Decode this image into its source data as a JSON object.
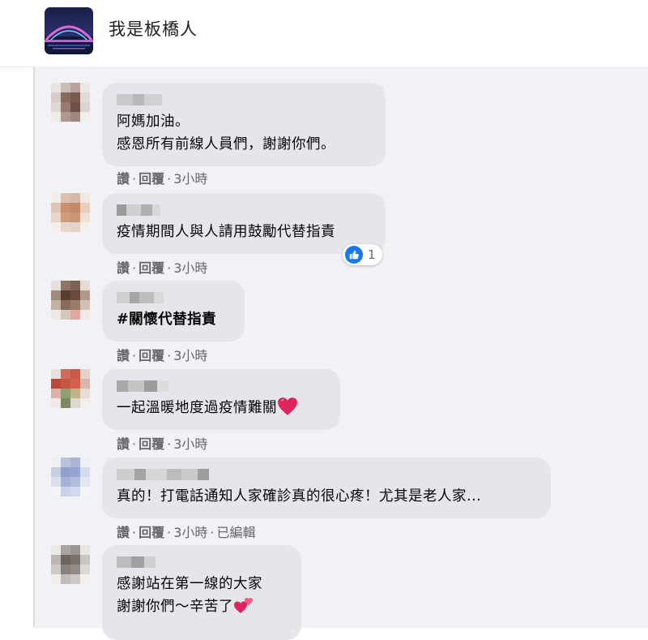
{
  "group": {
    "name": "我是板橋人"
  },
  "comments": [
    {
      "lines": [
        "阿媽加油。",
        "感恩所有前線人員們，謝謝你們。"
      ],
      "actions": {
        "like": "讚",
        "reply": "回覆",
        "time": "3小時"
      }
    },
    {
      "lines": [
        "疫情期間人與人請用鼓勵代替指責"
      ],
      "actions": {
        "like": "讚",
        "reply": "回覆",
        "time": "3小時"
      },
      "reaction": {
        "icon": "thumbs-up-icon",
        "count": "1"
      }
    },
    {
      "lines": [
        "#關懷代替指責"
      ],
      "actions": {
        "like": "讚",
        "reply": "回覆",
        "time": "3小時"
      }
    },
    {
      "lines": [
        "一起溫暖地度過疫情難關"
      ],
      "emoji": "red-heart-icon",
      "actions": {
        "like": "讚",
        "reply": "回覆",
        "time": "3小時"
      }
    },
    {
      "lines": [
        "真的！打電話通知人家確診真的很心疼！尤其是老人家..."
      ],
      "actions": {
        "like": "讚",
        "reply": "回覆",
        "time": "3小時",
        "edited": "已編輯"
      }
    },
    {
      "lines": [
        "感謝站在第一線的大家",
        "謝謝你們～辛苦了"
      ],
      "emoji": "two-hearts-icon"
    }
  ],
  "colors": {
    "bubble": "#e4e6eb",
    "feed_background": "#f0f2f5",
    "meta_text": "#65676b",
    "like_blue": "#1877f2",
    "heart_red": "#e0245e"
  }
}
